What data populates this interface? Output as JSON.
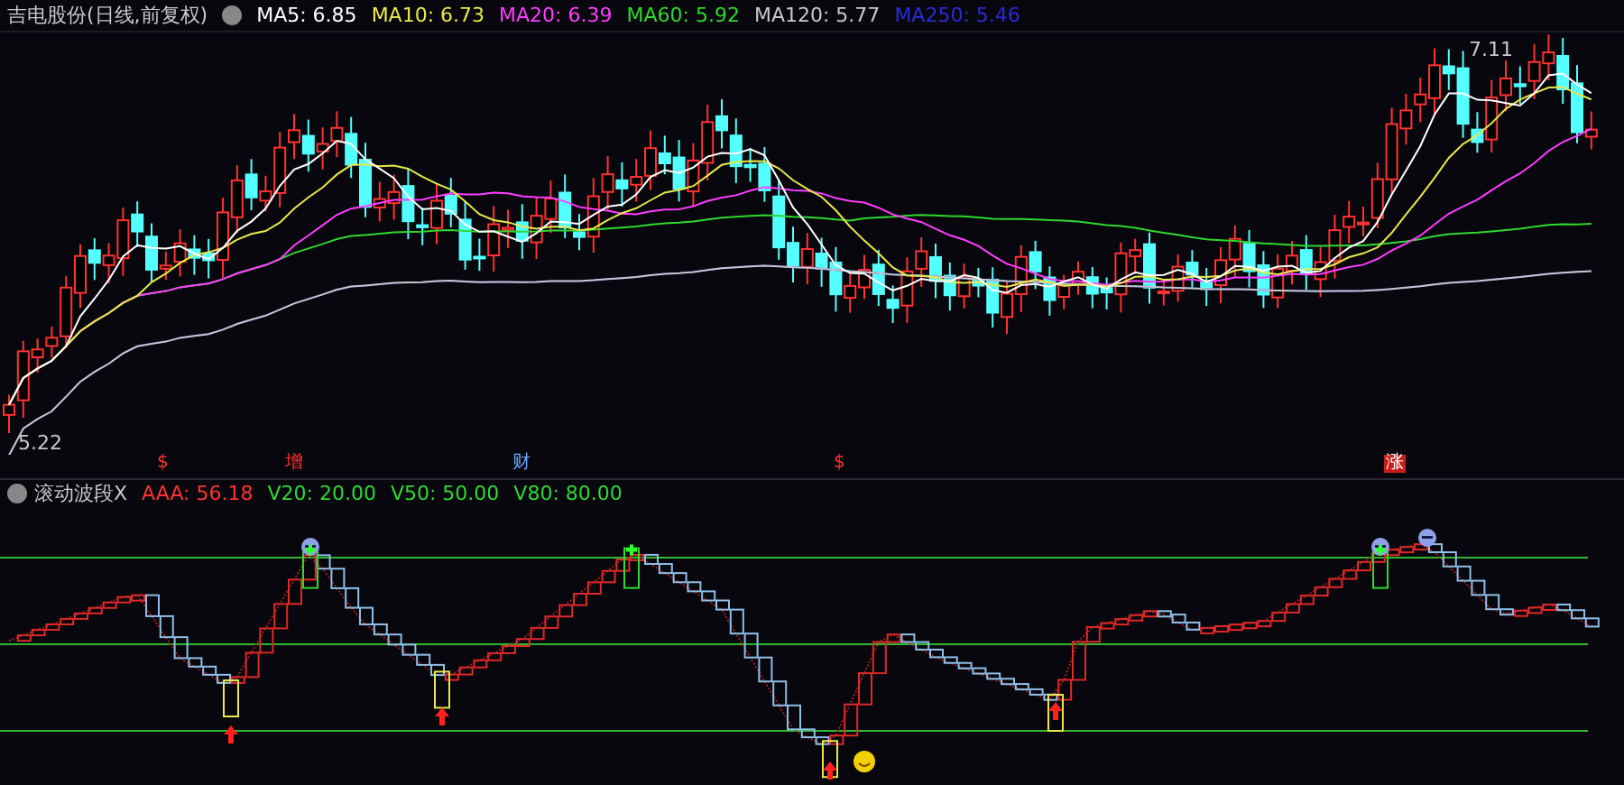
{
  "main_chart": {
    "title": "吉电股份(日线,前复权)",
    "indicators": [
      {
        "label": "MA5: 6.85",
        "color": "#ffffff"
      },
      {
        "label": "MA10: 6.73",
        "color": "#e8e84a"
      },
      {
        "label": "MA20: 6.39",
        "color": "#ff3cff"
      },
      {
        "label": "MA60: 5.92",
        "color": "#2fd82f"
      },
      {
        "label": "MA120: 5.77",
        "color": "#c8c8c8"
      },
      {
        "label": "MA250: 5.46",
        "color": "#2a2ad8"
      }
    ],
    "high_label": "7.11",
    "low_label": "5.22"
  },
  "event_markers": [
    {
      "label": "$",
      "kind": "text",
      "color": "#ff3232"
    },
    {
      "label": "增",
      "kind": "text",
      "color": "#ff3232"
    },
    {
      "label": "财",
      "kind": "text",
      "color": "#6fa8ff"
    },
    {
      "label": "$",
      "kind": "text",
      "color": "#ff3232"
    },
    {
      "label": "涨",
      "kind": "boxed",
      "color": "#c81e1e"
    }
  ],
  "sub_chart": {
    "title": "滚动波段X",
    "indicators": [
      {
        "label": "AAA: 56.18",
        "color": "#ff3232"
      },
      {
        "label": "V20: 20.00",
        "color": "#2fd82f"
      },
      {
        "label": "V50: 50.00",
        "color": "#2fd82f"
      },
      {
        "label": "V80: 80.00",
        "color": "#2fd82f"
      }
    ]
  }
}
